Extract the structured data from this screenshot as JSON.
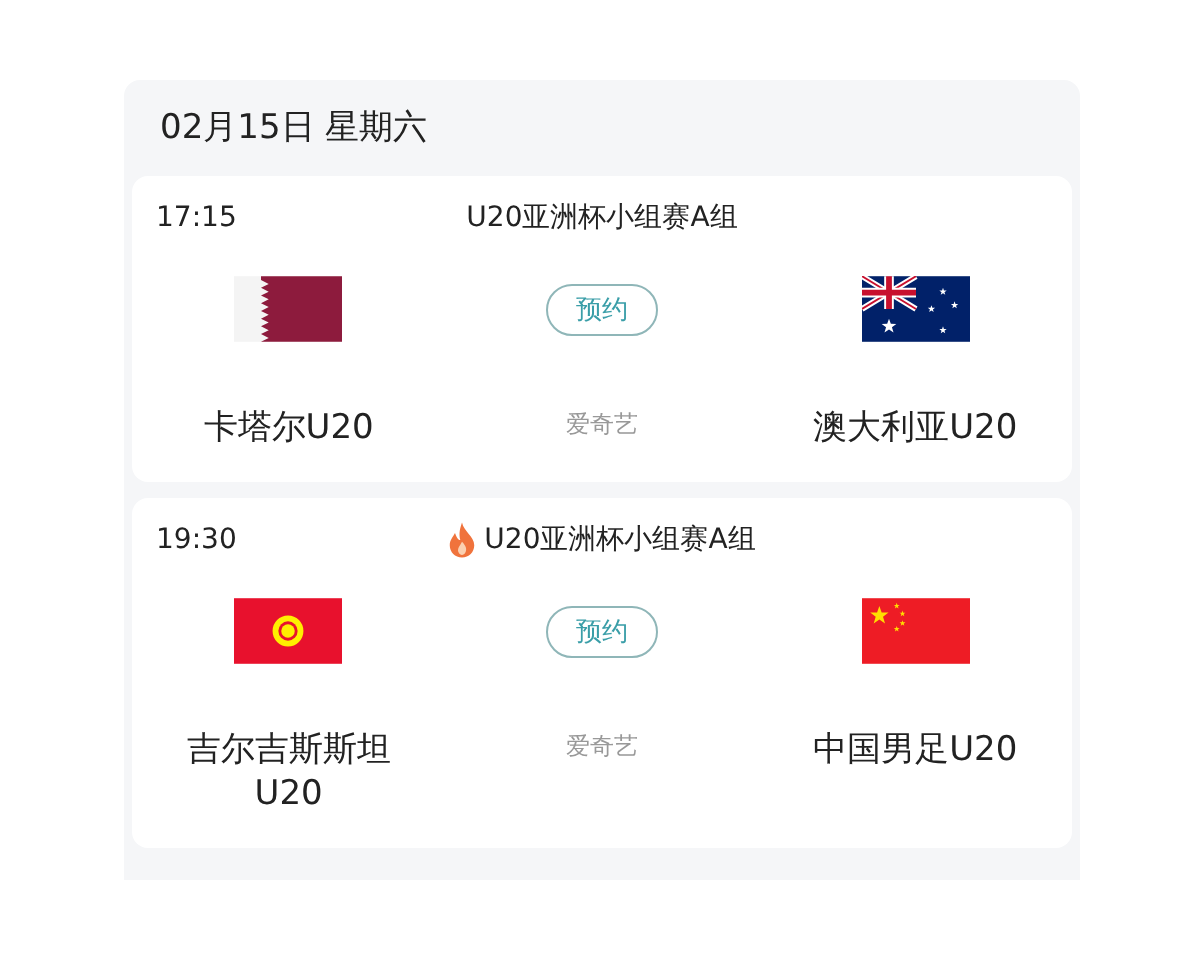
{
  "date": "02月15日 星期六",
  "matches": [
    {
      "time": "17:15",
      "hot": false,
      "competition": "U20亚洲杯小组赛A组",
      "home": {
        "name": "卡塔尔U20",
        "kind": "qatar"
      },
      "away": {
        "name": "澳大利亚U20",
        "kind": "australia"
      },
      "button": "预约",
      "platform": "爱奇艺"
    },
    {
      "time": "19:30",
      "hot": true,
      "competition": "U20亚洲杯小组赛A组",
      "home": {
        "name": "吉尔吉斯斯坦U20",
        "kind": "kyrgyzstan"
      },
      "away": {
        "name": "中国男足U20",
        "kind": "china"
      },
      "button": "预约",
      "platform": "爱奇艺"
    }
  ]
}
